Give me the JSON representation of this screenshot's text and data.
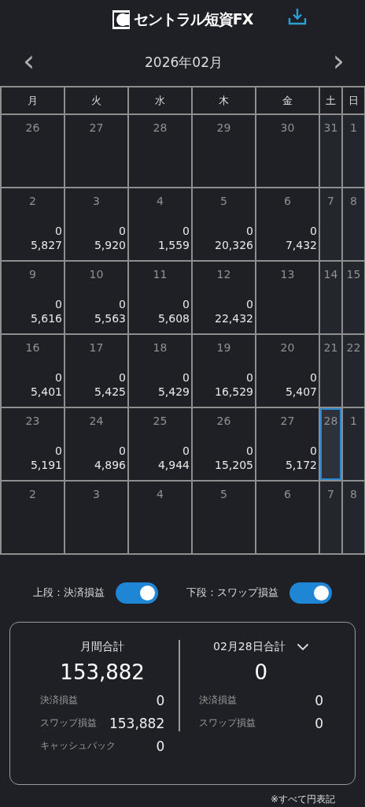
{
  "header": {
    "logo_text": "セントラル短資FX"
  },
  "month_nav": {
    "prev": "‹",
    "title": "2026年02月",
    "next": "›"
  },
  "calendar": {
    "weekdays": [
      {
        "label": "月",
        "kind": "weekday"
      },
      {
        "label": "火",
        "kind": "weekday"
      },
      {
        "label": "水",
        "kind": "weekday"
      },
      {
        "label": "木",
        "kind": "weekday"
      },
      {
        "label": "金",
        "kind": "weekday"
      },
      {
        "label": "土",
        "kind": "weekend"
      },
      {
        "label": "日",
        "kind": "weekend"
      }
    ],
    "weeks": [
      [
        {
          "day": "26",
          "selected": false
        },
        {
          "day": "27",
          "selected": false
        },
        {
          "day": "28",
          "selected": false
        },
        {
          "day": "29",
          "selected": false
        },
        {
          "day": "30",
          "selected": false
        },
        {
          "day": "31",
          "selected": false
        },
        {
          "day": "1",
          "selected": false
        }
      ],
      [
        {
          "day": "2",
          "settlement": "0",
          "swap": "5,827",
          "selected": false
        },
        {
          "day": "3",
          "settlement": "0",
          "swap": "5,920",
          "selected": false
        },
        {
          "day": "4",
          "settlement": "0",
          "swap": "1,559",
          "selected": false
        },
        {
          "day": "5",
          "settlement": "0",
          "swap": "20,326",
          "selected": false
        },
        {
          "day": "6",
          "settlement": "0",
          "swap": "7,432",
          "selected": false
        },
        {
          "day": "7",
          "selected": false
        },
        {
          "day": "8",
          "selected": false
        }
      ],
      [
        {
          "day": "9",
          "settlement": "0",
          "swap": "5,616",
          "selected": false
        },
        {
          "day": "10",
          "settlement": "0",
          "swap": "5,563",
          "selected": false
        },
        {
          "day": "11",
          "settlement": "0",
          "swap": "5,608",
          "selected": false
        },
        {
          "day": "12",
          "settlement": "0",
          "swap": "22,432",
          "selected": false
        },
        {
          "day": "13",
          "selected": false
        },
        {
          "day": "14",
          "selected": false
        },
        {
          "day": "15",
          "selected": false
        }
      ],
      [
        {
          "day": "16",
          "settlement": "0",
          "swap": "5,401",
          "selected": false
        },
        {
          "day": "17",
          "settlement": "0",
          "swap": "5,425",
          "selected": false
        },
        {
          "day": "18",
          "settlement": "0",
          "swap": "5,429",
          "selected": false
        },
        {
          "day": "19",
          "settlement": "0",
          "swap": "16,529",
          "selected": false
        },
        {
          "day": "20",
          "settlement": "0",
          "swap": "5,407",
          "selected": false
        },
        {
          "day": "21",
          "selected": false
        },
        {
          "day": "22",
          "selected": false
        }
      ],
      [
        {
          "day": "23",
          "settlement": "0",
          "swap": "5,191",
          "selected": false
        },
        {
          "day": "24",
          "settlement": "0",
          "swap": "4,896",
          "selected": false
        },
        {
          "day": "25",
          "settlement": "0",
          "swap": "4,944",
          "selected": false
        },
        {
          "day": "26",
          "settlement": "0",
          "swap": "15,205",
          "selected": false
        },
        {
          "day": "27",
          "settlement": "0",
          "swap": "5,172",
          "selected": false
        },
        {
          "day": "28",
          "selected": true
        },
        {
          "day": "1",
          "selected": false
        }
      ],
      [
        {
          "day": "2",
          "selected": false
        },
        {
          "day": "3",
          "selected": false
        },
        {
          "day": "4",
          "selected": false
        },
        {
          "day": "5",
          "selected": false
        },
        {
          "day": "6",
          "selected": false
        },
        {
          "day": "7",
          "selected": false
        },
        {
          "day": "8",
          "selected": false
        }
      ]
    ]
  },
  "toggles": [
    {
      "label": "上段：決済損益",
      "on": true
    },
    {
      "label": "下段：スワップ損益",
      "on": true
    }
  ],
  "summary": {
    "monthly": {
      "title": "月間合計",
      "total": "153,882",
      "rows": [
        {
          "label": "決済損益",
          "value": "0"
        },
        {
          "label": "スワップ損益",
          "value": "153,882"
        },
        {
          "label": "キャッシュバック",
          "value": "0"
        }
      ]
    },
    "daily": {
      "title": "02月28日合計",
      "total": "0",
      "rows": [
        {
          "label": "決済損益",
          "value": "0"
        },
        {
          "label": "スワップ損益",
          "value": "0"
        }
      ]
    }
  },
  "footnote": "※すべて円表記"
}
